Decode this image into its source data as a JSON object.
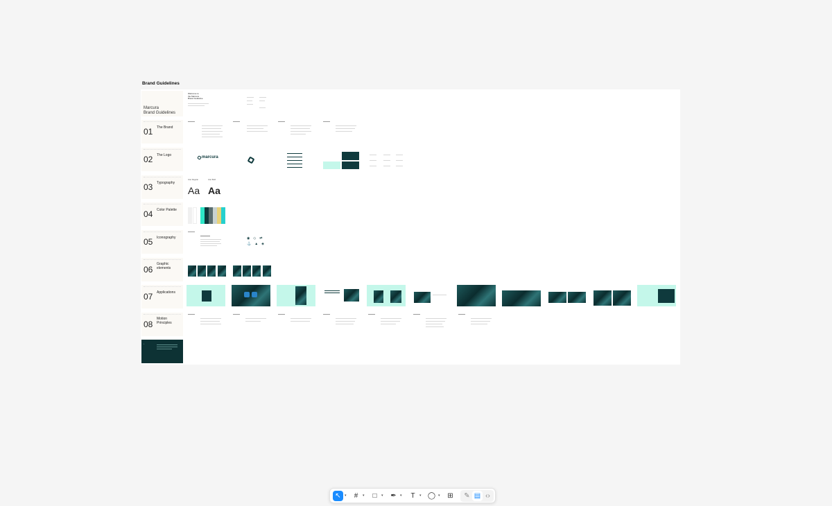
{
  "canvas": {
    "page_title": "Brand Guidelines"
  },
  "cover": {
    "title_line1": "Marcura",
    "title_line2": "Brand Guidelines",
    "welcome_line1": "Welcome to",
    "welcome_line2": "the Marcura",
    "welcome_line3": "Brand Guideline"
  },
  "sections": [
    {
      "num": "01",
      "label": "The Brand"
    },
    {
      "num": "02",
      "label": "The Logo"
    },
    {
      "num": "03",
      "label": "Typography"
    },
    {
      "num": "04",
      "label": "Color Palette"
    },
    {
      "num": "05",
      "label": "Iconography"
    },
    {
      "num": "06",
      "label": "Graphic elements"
    },
    {
      "num": "07",
      "label": "Applications"
    },
    {
      "num": "08",
      "label": "Motion Principles"
    }
  ],
  "logo": {
    "wordmark": "marcura"
  },
  "typography": {
    "sample": "Aa",
    "regular_caption": "Inter Regular",
    "bold_caption": "Inter Bold"
  },
  "palette": {
    "colors": [
      "#f0f0f0",
      "#ffffff",
      "#2ee6c8",
      "#0f3a3d",
      "#5b6e70",
      "#c8d2d0",
      "#e8d27a",
      "#26d0ce"
    ]
  },
  "toolbar": {
    "move_tool_icon": "cursor-arrow-icon",
    "frame_tool_icon": "hash-frame-icon",
    "shape_tool_icon": "rectangle-icon",
    "pen_tool_icon": "pen-icon",
    "text_tool_icon": "text-icon",
    "comment_tool_icon": "comment-icon",
    "actions_icon": "actions-grid-icon",
    "accent": "#1a8cff"
  }
}
